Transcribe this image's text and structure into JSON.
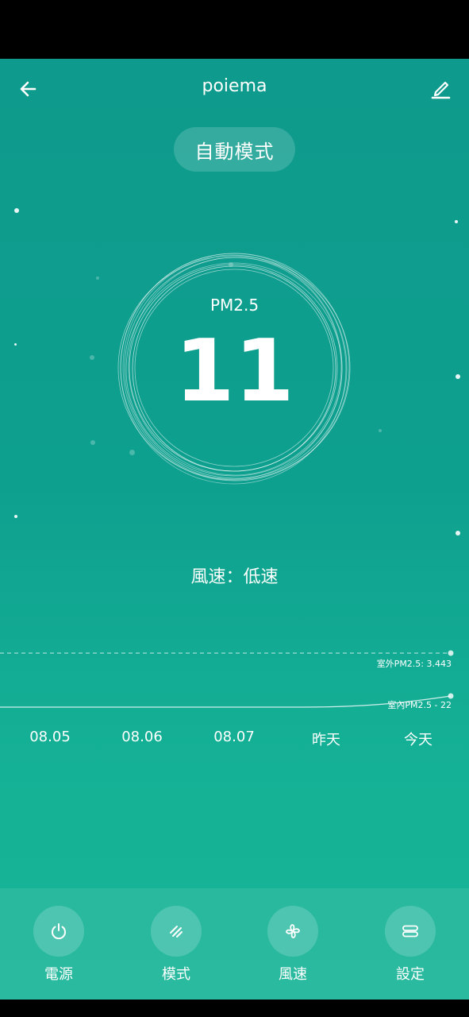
{
  "header": {
    "title": "poiema",
    "back_icon": "arrow-left-icon",
    "edit_icon": "pencil-icon"
  },
  "mode": {
    "label": "自動模式"
  },
  "reading": {
    "label": "PM2.5",
    "value": "11"
  },
  "fan": {
    "status": "風速：低速"
  },
  "chart": {
    "outdoor_label": "室外PM2.5: 3.443",
    "indoor_label": "室內PM2.5 - 22",
    "dates": [
      "08.05",
      "08.06",
      "08.07",
      "昨天",
      "今天"
    ]
  },
  "chart_data": {
    "type": "line",
    "categories": [
      "08.05",
      "08.06",
      "08.07",
      "昨天",
      "今天"
    ],
    "series": [
      {
        "name": "室外PM2.5",
        "values": [
          3.443,
          3.443,
          3.443,
          3.443,
          3.443
        ]
      },
      {
        "name": "室內PM2.5",
        "values": [
          12,
          12,
          12,
          14,
          22
        ]
      }
    ]
  },
  "controls": [
    {
      "label": "電源",
      "icon": "power-icon"
    },
    {
      "label": "模式",
      "icon": "mode-slash-icon"
    },
    {
      "label": "風速",
      "icon": "fan-icon"
    },
    {
      "label": "設定",
      "icon": "settings-icon"
    }
  ],
  "colors": {
    "background_top": "#0e9a8c",
    "background_bottom": "#17b597",
    "foreground": "#ffffff"
  }
}
